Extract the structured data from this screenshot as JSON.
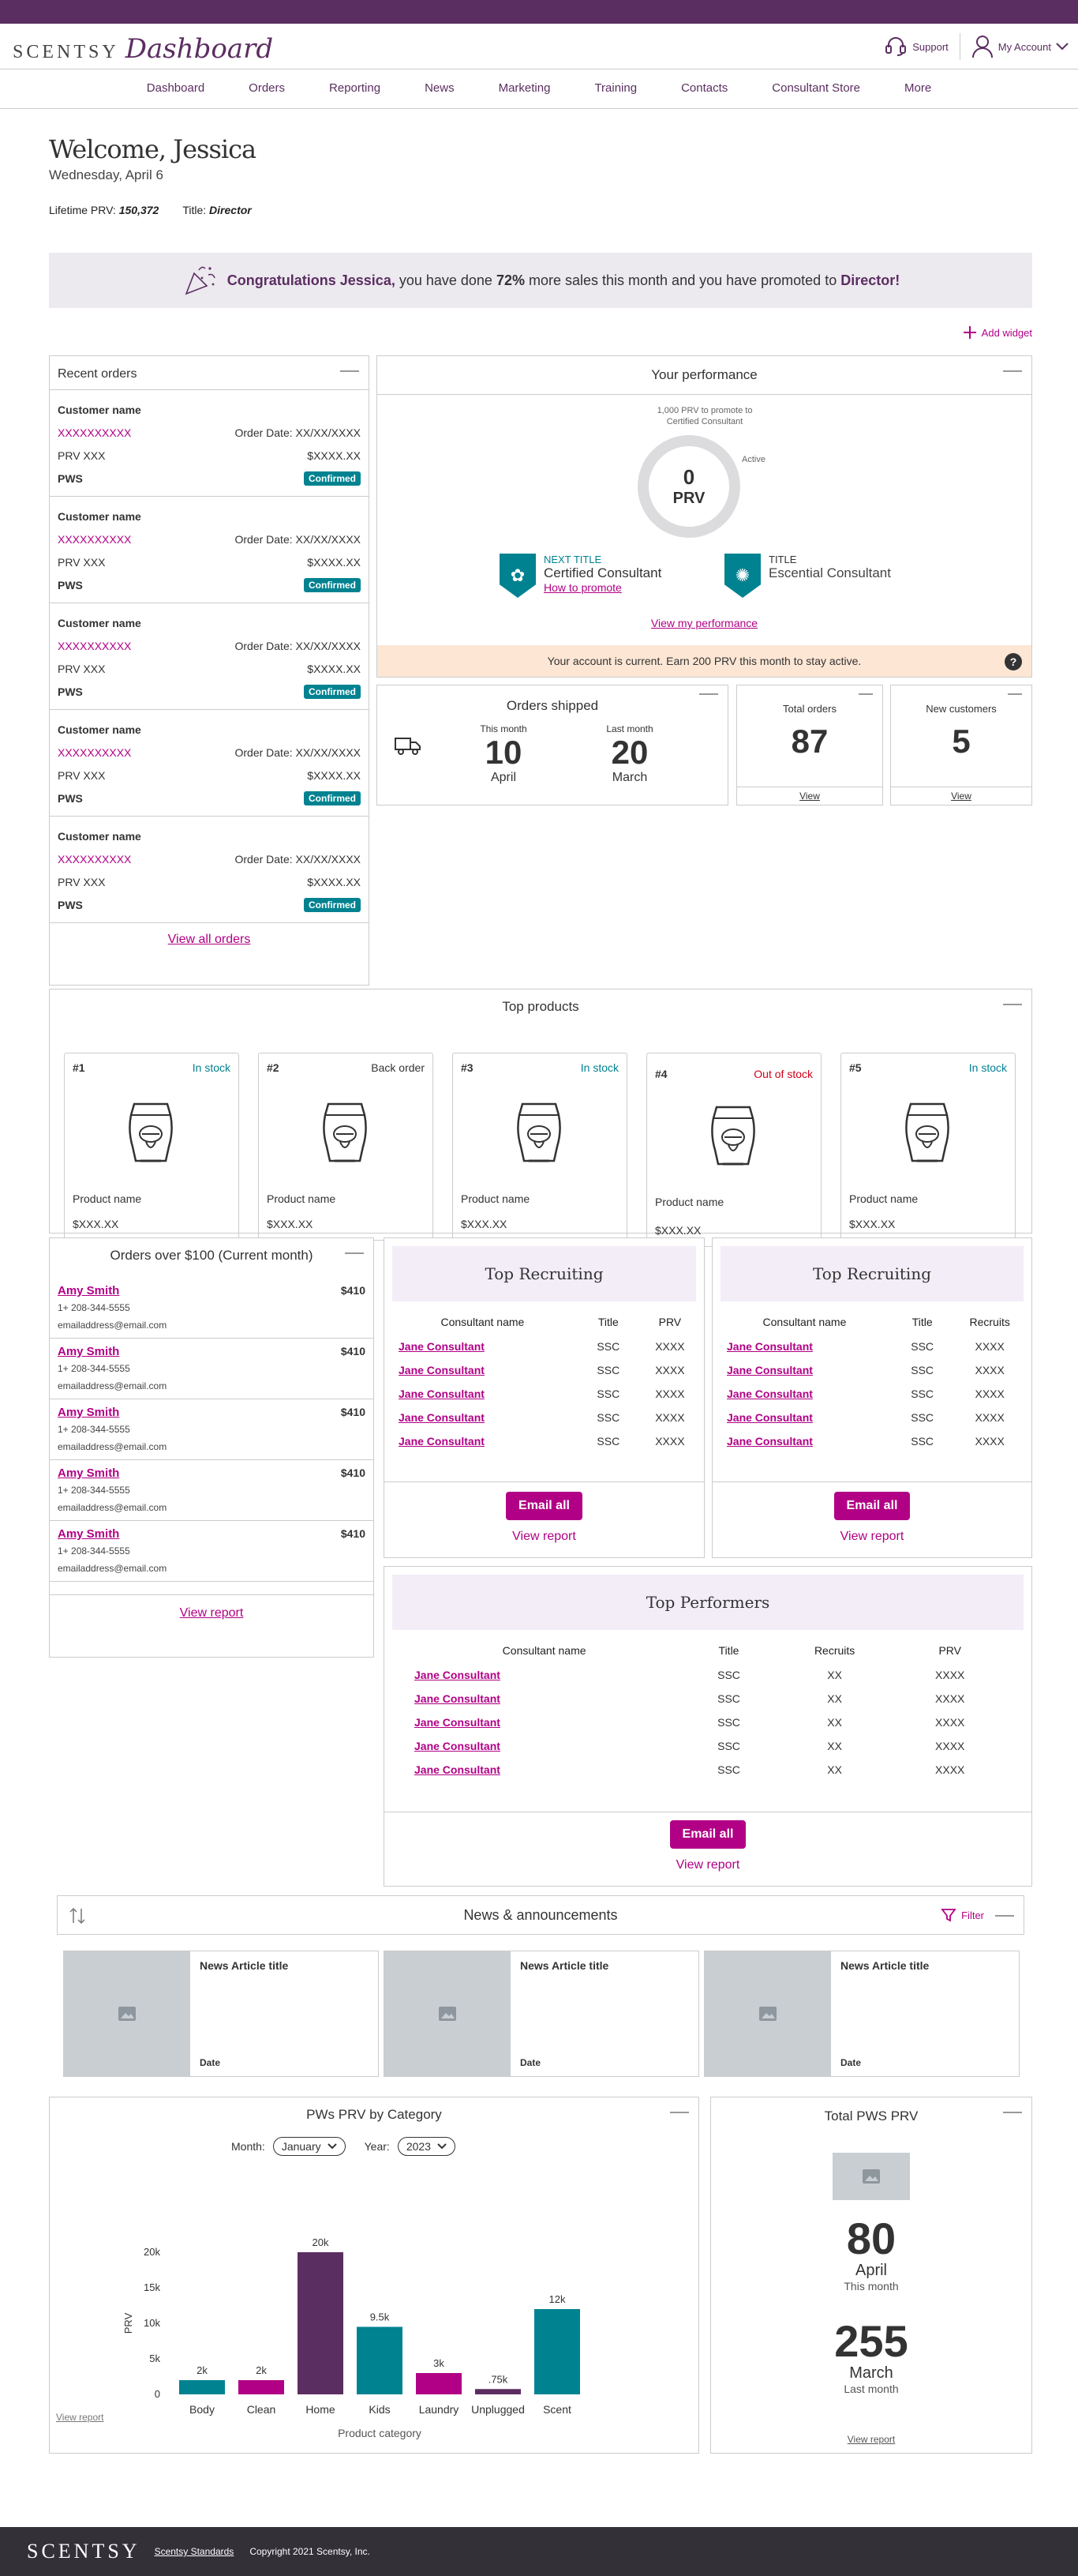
{
  "header": {
    "brand": "SCENTSY",
    "app_title": "Dashboard",
    "support_label": "Support",
    "account_label": "My Account"
  },
  "nav": [
    "Dashboard",
    "Orders",
    "Reporting",
    "News",
    "Marketing",
    "Training",
    "Contacts",
    "Consultant Store",
    "More"
  ],
  "welcome": {
    "title": "Welcome, Jessica",
    "date": "Wednesday, April 6",
    "lifetime_label": "Lifetime PRV:",
    "lifetime_value": "150,372",
    "title_label": "Title:",
    "title_value": "Director"
  },
  "congrats": {
    "lead": "Congratulations Jessica,",
    "text1": " you have done ",
    "percent": "72%",
    "text2": " more sales this month and you have promoted to ",
    "rank": "Director!"
  },
  "add_widget": "Add widget",
  "recent_orders": {
    "title": "Recent orders",
    "orders": [
      {
        "name": "Customer name",
        "number": "XXXXXXXXXX",
        "date": "Order Date: XX/XX/XXXX",
        "prv": "PRV XXX",
        "amount": "$XXXX.XX",
        "type": "PWS",
        "status": "Confirmed"
      },
      {
        "name": "Customer name",
        "number": "XXXXXXXXXX",
        "date": "Order Date: XX/XX/XXXX",
        "prv": "PRV XXX",
        "amount": "$XXXX.XX",
        "type": "PWS",
        "status": "Confirmed"
      },
      {
        "name": "Customer name",
        "number": "XXXXXXXXXX",
        "date": "Order Date: XX/XX/XXXX",
        "prv": "PRV XXX",
        "amount": "$XXXX.XX",
        "type": "PWS",
        "status": "Confirmed"
      },
      {
        "name": "Customer name",
        "number": "XXXXXXXXXX",
        "date": "Order Date: XX/XX/XXXX",
        "prv": "PRV XXX",
        "amount": "$XXXX.XX",
        "type": "PWS",
        "status": "Confirmed"
      },
      {
        "name": "Customer name",
        "number": "XXXXXXXXXX",
        "date": "Order Date: XX/XX/XXXX",
        "prv": "PRV XXX",
        "amount": "$XXXX.XX",
        "type": "PWS",
        "status": "Confirmed"
      }
    ],
    "view_all": "View all orders"
  },
  "performance": {
    "title": "Your performance",
    "ring_caption_1": "1,000 PRV to promote to",
    "ring_caption_2": "Certified Consultant",
    "ring_value": "0",
    "ring_unit": "PRV",
    "ring_progress": 0,
    "active_label": "Active",
    "next_title_label": "NEXT TITLE",
    "next_title_value": "Certified Consultant",
    "how_to_promote": "How to promote",
    "title_label": "TITLE",
    "title_value": "Escential Consultant",
    "view_link": "View my performance",
    "notice": "Your account is current. Earn 200 PRV this month to stay active."
  },
  "orders_shipped": {
    "title": "Orders shipped",
    "this_label": "This month",
    "this_value": "10",
    "this_month": "April",
    "last_label": "Last month",
    "last_value": "20",
    "last_month": "March"
  },
  "total_orders": {
    "title": "Total orders",
    "value": "87",
    "view": "View"
  },
  "new_customers": {
    "title": "New customers",
    "value": "5",
    "view": "View"
  },
  "top_products": {
    "title": "Top products",
    "items": [
      {
        "rank": "#1",
        "stock": "In stock",
        "name": "Product name",
        "price": "$XXX.XX"
      },
      {
        "rank": "#2",
        "stock": "Back order",
        "name": "Product name",
        "price": "$XXX.XX"
      },
      {
        "rank": "#3",
        "stock": "In stock",
        "name": "Product name",
        "price": "$XXX.XX"
      },
      {
        "rank": "#4",
        "stock": "Out of stock",
        "name": "Product name",
        "price": "$XXX.XX"
      },
      {
        "rank": "#5",
        "stock": "In stock",
        "name": "Product name",
        "price": "$XXX.XX"
      }
    ],
    "colors": {
      "in": "#008291",
      "back": "#333333",
      "out": "#d0021b"
    }
  },
  "orders100": {
    "title": "Orders over $100 (Current month)",
    "entries": [
      {
        "name": "Amy Smith",
        "amount": "$410",
        "phone": "1+ 208-344-5555",
        "email": "emailaddress@email.com"
      },
      {
        "name": "Amy Smith",
        "amount": "$410",
        "phone": "1+ 208-344-5555",
        "email": "emailaddress@email.com"
      },
      {
        "name": "Amy Smith",
        "amount": "$410",
        "phone": "1+ 208-344-5555",
        "email": "emailaddress@email.com"
      },
      {
        "name": "Amy Smith",
        "amount": "$410",
        "phone": "1+ 208-344-5555",
        "email": "emailaddress@email.com"
      },
      {
        "name": "Amy Smith",
        "amount": "$410",
        "phone": "1+ 208-344-5555",
        "email": "emailaddress@email.com"
      }
    ],
    "view_report": "View report"
  },
  "recruiting_prv": {
    "title": "Top Recruiting",
    "headers": [
      "Consultant name",
      "Title",
      "PRV"
    ],
    "rows": [
      [
        "Jane Consultant",
        "SSC",
        "XXXX"
      ],
      [
        "Jane Consultant",
        "SSC",
        "XXXX"
      ],
      [
        "Jane Consultant",
        "SSC",
        "XXXX"
      ],
      [
        "Jane Consultant",
        "SSC",
        "XXXX"
      ],
      [
        "Jane Consultant",
        "SSC",
        "XXXX"
      ]
    ],
    "email_all": "Email all",
    "view_report": "View report"
  },
  "recruiting_recruits": {
    "title": "Top Recruiting",
    "headers": [
      "Consultant name",
      "Title",
      "Recruits"
    ],
    "rows": [
      [
        "Jane Consultant",
        "SSC",
        "XXXX"
      ],
      [
        "Jane Consultant",
        "SSC",
        "XXXX"
      ],
      [
        "Jane Consultant",
        "SSC",
        "XXXX"
      ],
      [
        "Jane Consultant",
        "SSC",
        "XXXX"
      ],
      [
        "Jane Consultant",
        "SSC",
        "XXXX"
      ]
    ],
    "email_all": "Email all",
    "view_report": "View report"
  },
  "top_performers": {
    "title": "Top Performers",
    "headers": [
      "Consultant name",
      "Title",
      "Recruits",
      "PRV"
    ],
    "rows": [
      [
        "Jane Consultant",
        "SSC",
        "XX",
        "XXXX"
      ],
      [
        "Jane Consultant",
        "SSC",
        "XX",
        "XXXX"
      ],
      [
        "Jane Consultant",
        "SSC",
        "XX",
        "XXXX"
      ],
      [
        "Jane Consultant",
        "SSC",
        "XX",
        "XXXX"
      ],
      [
        "Jane Consultant",
        "SSC",
        "XX",
        "XXXX"
      ]
    ],
    "email_all": "Email all",
    "view_report": "View report"
  },
  "news": {
    "title": "News & announcements",
    "filter": "Filter",
    "items": [
      {
        "title": "News Article title",
        "date": "Date"
      },
      {
        "title": "News Article title",
        "date": "Date"
      },
      {
        "title": "News Article title",
        "date": "Date"
      }
    ]
  },
  "pws_chart": {
    "title": "PWs PRV by Category",
    "month_label": "Month:",
    "month_value": "January",
    "year_label": "Year:",
    "year_value": "2023",
    "view_report": "View report"
  },
  "chart_data": {
    "type": "bar",
    "categories": [
      "Body",
      "Clean",
      "Home",
      "Kids",
      "Laundry",
      "Unplugged",
      "Scent"
    ],
    "values": [
      2000,
      2000,
      20000,
      9500,
      3000,
      750,
      12000
    ],
    "data_labels": [
      "2k",
      "2k",
      "20k",
      "9.5k",
      "3k",
      ".75k",
      "12k"
    ],
    "colors": [
      "#008291",
      "#b10085",
      "#5b2e61",
      "#008291",
      "#b10085",
      "#5b2e61",
      "#008291"
    ],
    "ylabel": "PRV",
    "xlabel": "Product category",
    "ylim": [
      0,
      20000
    ],
    "yticks": [
      0,
      5000,
      10000,
      15000,
      20000
    ],
    "ytick_labels": [
      "0",
      "5k",
      "10k",
      "15k",
      "20k"
    ],
    "grid": false
  },
  "total_pws": {
    "title": "Total PWS PRV",
    "this_value": "80",
    "this_month": "April",
    "this_label": "This month",
    "last_value": "255",
    "last_month": "March",
    "last_label": "Last month",
    "view_report": "View report"
  },
  "footer": {
    "brand": "SCENTSY",
    "standards": "Scentsy Standards",
    "copyright": "Copyright 2021 Scentsy, Inc."
  }
}
